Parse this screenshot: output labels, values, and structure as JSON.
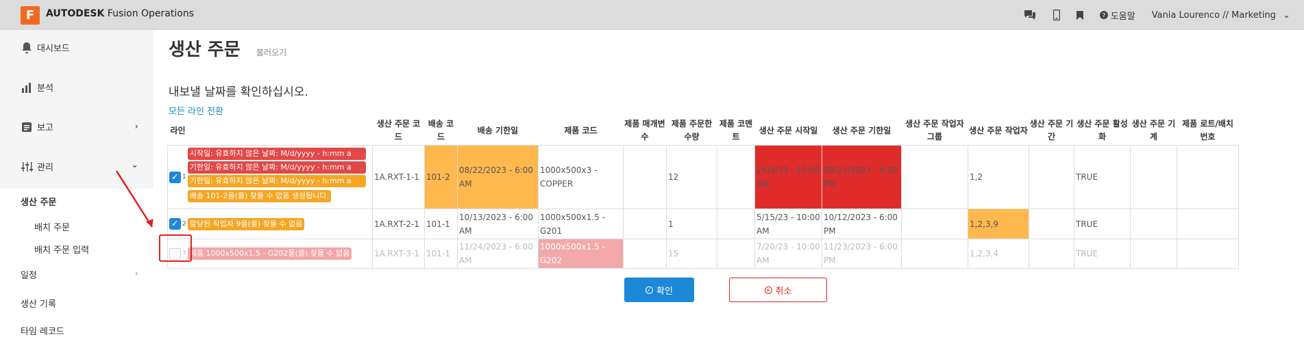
{
  "app": {
    "logo_letter": "F",
    "brand": "AUTODESK",
    "product": "Fusion Operations"
  },
  "topbar": {
    "help_label": "도움말",
    "user_label": "Vania Lourenco // Marketing"
  },
  "sidebar": {
    "dashboard": "대시보드",
    "analysis": "분석",
    "report": "보고",
    "manage": "관리",
    "production_order": "생산 주문",
    "batch_order": "배치 주문",
    "batch_order_input": "배치 주문 입력",
    "schedule": "일정",
    "production_log": "생산 기록",
    "time_record": "타임 레코드"
  },
  "page": {
    "title": "생산 주문",
    "subtitle": "불러오기",
    "prompt": "내보낼 날짜를 확인하십시오.",
    "toggle_all": "모든 라인 전환"
  },
  "table": {
    "headers": {
      "line": "라인",
      "po_code": "생산 주문 코드",
      "ship_code": "배송 코드",
      "ship_due": "배송 기한일",
      "product_code": "제품 코드",
      "product_param": "제품 매개변수",
      "order_qty": "제품 주문한 수량",
      "product_comment": "제품 코멘트",
      "po_start": "생산 주문 시작일",
      "po_due": "생산 주문 기한일",
      "worker_group": "생산 주문 작업자 그룹",
      "worker": "생산 주문 작업자",
      "period": "생산 주문 기간",
      "active": "생산 주문 활성화",
      "machine": "생산 주문 기계",
      "lot": "제품 로트/배치 번호"
    },
    "rows": [
      {
        "num": "1",
        "checked": true,
        "messages": [
          {
            "text": "시작일: 유효하지 않은 날짜: M/d/yyyy - h:mm a",
            "color": "red"
          },
          {
            "text": "기한일: 유효하지 않은 날짜: M/d/yyyy - h:mm a",
            "color": "red"
          },
          {
            "text": "기한일: 유효하지 않은 날짜: M/d/yyyy - h:mm a",
            "color": "orange"
          },
          {
            "text": "배송 101-2을(를) 찾을 수 없음 생성됩니다.",
            "color": "orange"
          }
        ],
        "po_code": "1A.RXT-1-1",
        "ship_code": "101-2",
        "ship_due": "08/22/2023 - 6:00 AM",
        "product_code": "1000x500x3 - COPPER",
        "product_param": "",
        "order_qty": "12",
        "product_comment": "",
        "po_start": "24/4/23 - 10:00 AM",
        "po_due": "08/21/2023 - 6:00 PM",
        "worker_group": "",
        "worker": "1,2",
        "period": "",
        "active": "TRUE",
        "machine": "",
        "lot": ""
      },
      {
        "num": "2",
        "checked": true,
        "messages": [
          {
            "text": "할당된 작업자 9을(를) 찾을 수 없음",
            "color": "orange"
          }
        ],
        "po_code": "1A.RXT-2-1",
        "ship_code": "101-1",
        "ship_due": "10/13/2023 - 6:00 AM",
        "product_code": "1000x500x1.5 - G201",
        "product_param": "",
        "order_qty": "1",
        "product_comment": "",
        "po_start": "5/15/23 - 10:00 AM",
        "po_due": "10/12/2023 - 6:00 PM",
        "worker_group": "",
        "worker": "1,2,3,9",
        "period": "",
        "active": "TRUE",
        "machine": "",
        "lot": ""
      },
      {
        "num": "3",
        "checked": false,
        "messages": [
          {
            "text": "제품 1000x500x1.5 - G202을(를) 찾을 수 없음",
            "color": "pink"
          }
        ],
        "po_code": "1A.RXT-3-1",
        "ship_code": "101-1",
        "ship_due": "11/24/2023 - 6:00 AM",
        "product_code": "1000x500x1.5 - G202",
        "product_param": "",
        "order_qty": "15",
        "product_comment": "",
        "po_start": "7/20/23 - 10:00 AM",
        "po_due": "11/23/2023 - 6:00 PM",
        "worker_group": "",
        "worker": "1,2,3,4",
        "period": "",
        "active": "TRUE",
        "machine": "",
        "lot": ""
      }
    ]
  },
  "buttons": {
    "confirm": "확인",
    "cancel": "취소"
  },
  "colors": {
    "accent": "#1e88d8",
    "brand": "#f26a21",
    "error": "#e02b2b",
    "warning": "#ffb84d"
  }
}
